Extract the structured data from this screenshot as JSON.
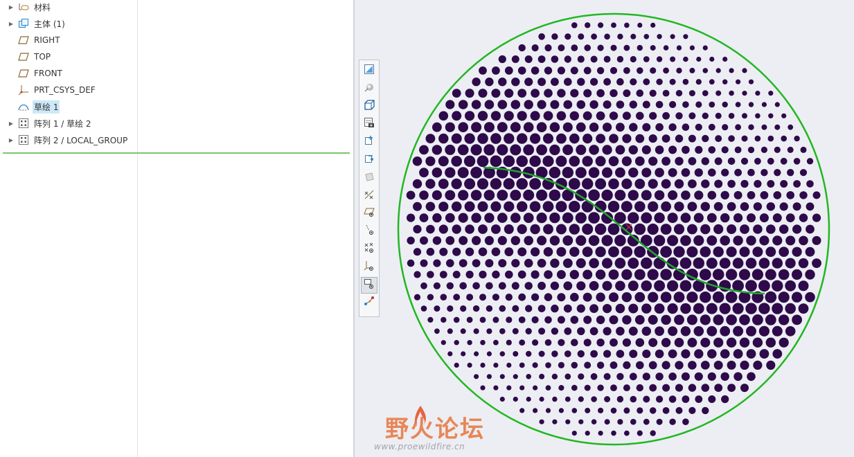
{
  "model_tree": {
    "items": [
      {
        "label": "材料",
        "icon": "material-icon",
        "expandable": true
      },
      {
        "label": "主体 (1)",
        "icon": "body-icon",
        "expandable": true
      },
      {
        "label": "RIGHT",
        "icon": "datum-plane-icon",
        "expandable": false
      },
      {
        "label": "TOP",
        "icon": "datum-plane-icon",
        "expandable": false
      },
      {
        "label": "FRONT",
        "icon": "datum-plane-icon",
        "expandable": false
      },
      {
        "label": "PRT_CSYS_DEF",
        "icon": "coordinate-system-icon",
        "expandable": false
      },
      {
        "label": "草绘 1",
        "icon": "sketch-icon",
        "expandable": false,
        "selected": true
      },
      {
        "label": "阵列 1 / 草绘 2",
        "icon": "pattern-icon",
        "expandable": true
      },
      {
        "label": "阵列 2 / LOCAL_GROUP",
        "icon": "pattern-icon",
        "expandable": true
      }
    ]
  },
  "view_toolbar": {
    "buttons": [
      {
        "name": "refit-button",
        "icon": "refit-icon"
      },
      {
        "name": "display-style-button",
        "icon": "shading-icon"
      },
      {
        "name": "saved-orientations-button",
        "icon": "view-cube-icon"
      },
      {
        "name": "view-manager-button",
        "icon": "view-manager-icon"
      },
      {
        "name": "zoom-in-button",
        "icon": "zoom-in-icon"
      },
      {
        "name": "zoom-out-button",
        "icon": "zoom-out-icon"
      },
      {
        "name": "repaint-button",
        "icon": "repaint-icon"
      },
      {
        "name": "datum-display-button",
        "icon": "datum-display-icon"
      },
      {
        "name": "plane-display-button",
        "icon": "plane-display-icon"
      },
      {
        "name": "axis-display-button",
        "icon": "axis-display-icon"
      },
      {
        "name": "point-display-button",
        "icon": "point-display-icon"
      },
      {
        "name": "csys-display-button",
        "icon": "csys-display-icon"
      },
      {
        "name": "annotation-display-button",
        "icon": "annotation-display-icon",
        "pressed": true
      },
      {
        "name": "spin-center-button",
        "icon": "spin-center-icon"
      }
    ]
  },
  "colors": {
    "dot_fill": "#2e0a4a",
    "boundary_circle": "#22b722",
    "curve": "#1fa52a",
    "background": "#eceef3",
    "tree_selection": "#cde8f8"
  },
  "watermark": {
    "title": "野火论坛",
    "url": "www.proewildfire.cn"
  }
}
